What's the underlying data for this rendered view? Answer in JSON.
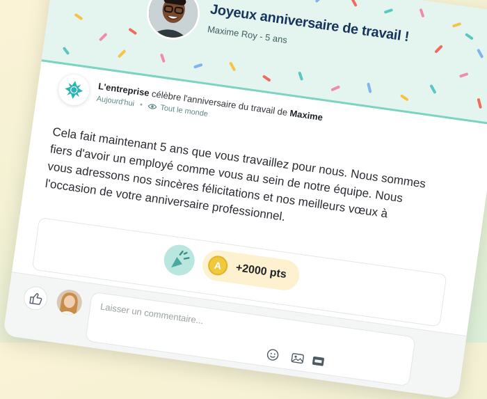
{
  "banner": {
    "title": "Joyeux anniversaire de travail !",
    "subtitle": "Maxime Roy - 5 ans"
  },
  "post": {
    "company": "L'entreprise",
    "action": " célèbre l'anniversaire du travail de ",
    "person": "Maxime",
    "time": "Aujourd'hui",
    "separator": "•",
    "audience": "Tout le monde",
    "message": "Cela fait maintenant 5 ans que vous travaillez pour nous. Nous sommes fiers d'avoir un employé comme vous au sein de notre équipe. Nous vous adressons nos sincères félicitations et nos meilleurs vœux à l'occasion de votre anniversaire professionnel."
  },
  "reward": {
    "points": "+2000 pts",
    "coin_symbol": "A"
  },
  "comment": {
    "placeholder": "Laisser un commentaire..."
  },
  "colors": {
    "banner_bg": "#e4f4ee",
    "accent": "#7cd3c2",
    "title": "#17355c",
    "coin": "#f0c93e"
  },
  "icons": [
    "party-popper-icon",
    "company-logo-icon",
    "eye-icon",
    "thumbs-up-icon",
    "emoji-icon",
    "image-icon",
    "gif-icon",
    "coin-icon",
    "confetti-badge-icon"
  ]
}
